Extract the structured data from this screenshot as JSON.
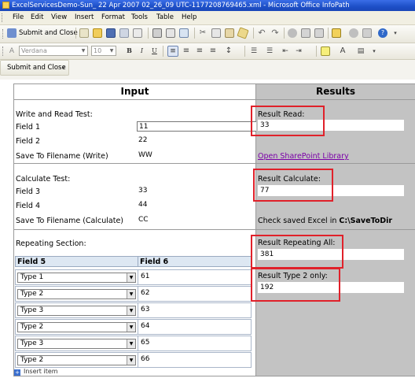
{
  "window": {
    "title": "ExcelServicesDemo-Sun_ 22 Apr 2007 02_26_09 UTC-1177208769465.xml - Microsoft Office InfoPath"
  },
  "menu": [
    "File",
    "Edit",
    "View",
    "Insert",
    "Format",
    "Tools",
    "Table",
    "Help"
  ],
  "toolbar": {
    "submit_close": "Submit and Close",
    "font": "Verdana",
    "size": "10",
    "bold": "B",
    "italic": "I",
    "underline": "U"
  },
  "submit_bar": {
    "submit_close": "Submit and Close"
  },
  "form": {
    "input_header": "Input",
    "results_header": "Results",
    "write_read": {
      "heading": "Write and Read Test:",
      "field1_label": "Field 1",
      "field1_value": "11",
      "field2_label": "Field 2",
      "field2_value": "22",
      "save_label": "Save To Filename (Write)",
      "save_value": "WW"
    },
    "calculate": {
      "heading": "Calculate Test:",
      "field3_label": "Field 3",
      "field3_value": "33",
      "field4_label": "Field 4",
      "field4_value": "44",
      "save_label": "Save To Filename (Calculate)",
      "save_value": "CC"
    },
    "repeating": {
      "heading": "Repeating Section:",
      "col1": "Field 5",
      "col2": "Field 6",
      "rows": [
        {
          "type": "Type 1",
          "value": "61"
        },
        {
          "type": "Type 2",
          "value": "62"
        },
        {
          "type": "Type 3",
          "value": "63"
        },
        {
          "type": "Type 2",
          "value": "64"
        },
        {
          "type": "Type 3",
          "value": "65"
        },
        {
          "type": "Type 2",
          "value": "66"
        }
      ],
      "insert_item": "Insert item"
    },
    "results": {
      "read_label": "Result Read:",
      "read_value": "33",
      "link": "Open SharePoint Library",
      "calc_label": "Result Calculate:",
      "calc_value": "77",
      "check_text_prefix": "Check saved Excel in ",
      "check_text_path": "C:\\SaveToDir",
      "repeat_all_label": "Result Repeating All:",
      "repeat_all_value": "381",
      "type2_label": "Result Type 2 only:",
      "type2_value": "192"
    }
  },
  "colors": {
    "titlebar": "#1d4fc7",
    "highlight": "#e0212a",
    "results_bg": "#c3c3c3",
    "link": "#7b00a8"
  }
}
